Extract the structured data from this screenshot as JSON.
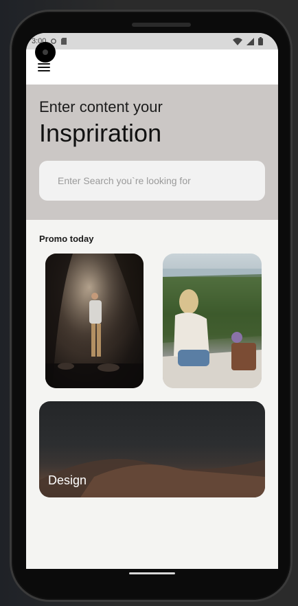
{
  "status_bar": {
    "time": "3:00",
    "icons": [
      "gear-icon",
      "sd-card-icon",
      "wifi-icon",
      "signal-icon",
      "battery-icon"
    ]
  },
  "app_bar": {
    "menu_icon": "hamburger-menu-icon"
  },
  "hero": {
    "subtitle": "Enter content your",
    "title": "Inspriration",
    "search": {
      "placeholder": "Enter Search you`re looking for",
      "value": ""
    }
  },
  "promo": {
    "section_title": "Promo today",
    "cards": [
      {
        "name": "cave-photo"
      },
      {
        "name": "lake-photo"
      }
    ],
    "banner": {
      "label": "Design"
    }
  },
  "colors": {
    "hero_bg": "#cbc7c5",
    "page_bg": "#f4f4f2",
    "app_bar_bg": "#ffffff",
    "search_bg": "#f2f2f2"
  }
}
